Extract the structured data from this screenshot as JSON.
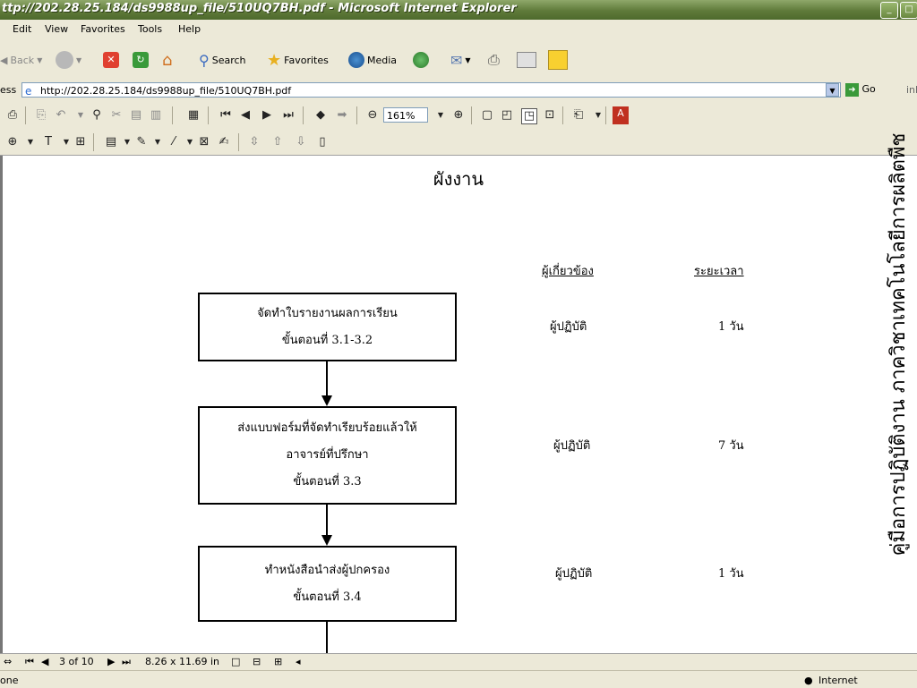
{
  "window": {
    "title": "ttp://202.28.25.184/ds9988up_file/510UQ7BH.pdf - Microsoft Internet Explorer"
  },
  "menu": [
    "Edit",
    "View",
    "Favorites",
    "Tools",
    "Help"
  ],
  "toolbar": {
    "back_label": "Back",
    "search_label": "Search",
    "favorites_label": "Favorites",
    "media_label": "Media"
  },
  "address": {
    "label": "ess",
    "url": "http://202.28.25.184/ds9988up_file/510UQ7BH.pdf",
    "go_label": "Go",
    "links_label": "ink"
  },
  "acrobat": {
    "zoom": "161%"
  },
  "document": {
    "title": "ผังงาน",
    "col_related": "ผู้เกี่ยวข้อง",
    "col_duration": "ระยะเวลา",
    "steps": [
      {
        "line1": "จัดทำใบรายงานผลการเรียน",
        "line2": "ขั้นตอนที่ 3.1-3.2",
        "line3": "",
        "related": "ผู้ปฏิบัติ",
        "duration": "1 วัน"
      },
      {
        "line1": "ส่งแบบฟอร์มที่จัดทำเรียบร้อยแล้วให้",
        "line2": "อาจารย์ที่ปรึกษา",
        "line3": "ขั้นตอนที่ 3.3",
        "related": "ผู้ปฏิบัติ",
        "duration": "7 วัน"
      },
      {
        "line1": "ทำหนังสือนำส่งผู้ปกครอง",
        "line2": "ขั้นตอนที่ 3.4",
        "line3": "",
        "related": "ผู้ปฏิบัติ",
        "duration": "1 วัน"
      }
    ],
    "side_text": "คู่มือการปฏิบัติงาน ภาควิชาเทคโนโลยีการผลิตพืช"
  },
  "navigation": {
    "page": "3 of 10",
    "page_size": "8.26 x 11.69 in"
  },
  "status": {
    "left": "one",
    "zone": "Internet"
  }
}
